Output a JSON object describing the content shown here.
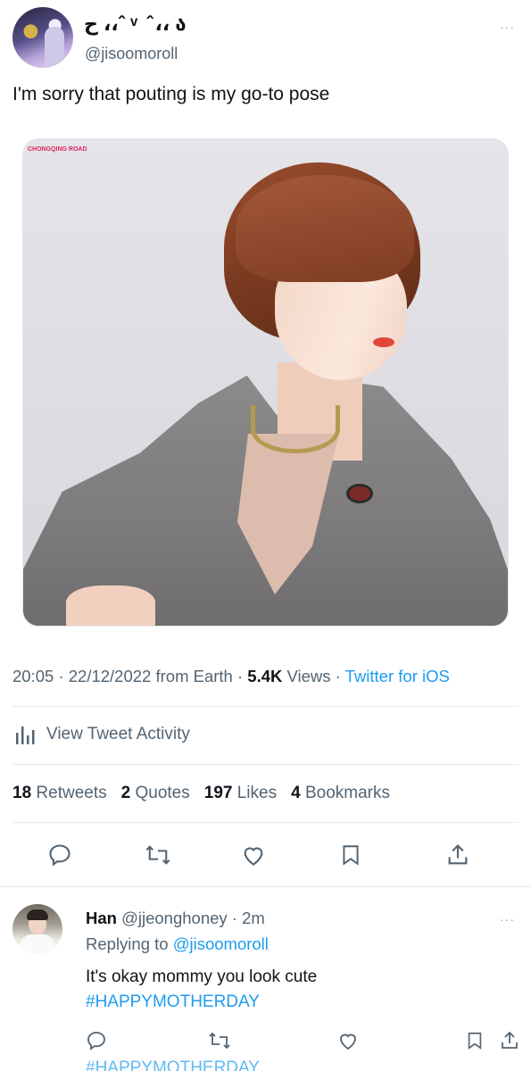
{
  "tweet": {
    "display_name": "ح ،،ˆ ᵛ ˆ،، ა",
    "handle": "@jisoomoroll",
    "text": "I'm sorry that pouting is my go-to pose",
    "photo_caption": "CHONGQING ROAD",
    "time": "20:05",
    "date": "22/12/2022",
    "from": "from Earth",
    "views_count": "5.4K",
    "views_label": "Views",
    "source": "Twitter for iOS",
    "sep": "·",
    "activity_label": "View Tweet Activity",
    "stats": {
      "retweets_count": "18",
      "retweets_label": "Retweets",
      "quotes_count": "2",
      "quotes_label": "Quotes",
      "likes_count": "197",
      "likes_label": "Likes",
      "bookmarks_count": "4",
      "bookmarks_label": "Bookmarks"
    },
    "more": "···"
  },
  "reply": {
    "name": "Han",
    "handle": "@jjeonghoney",
    "age": "2m",
    "sep": "·",
    "replying_prefix": "Replying to",
    "replying_handle": "@jisoomoroll",
    "text": "It's okay mommy you look cute",
    "hashtag": "#HAPPYMOTHERDAY",
    "cut_text": "#HAPPYMOTHERDAY",
    "more": "···"
  },
  "colors": {
    "link": "#1d9bf0",
    "muted": "#536471",
    "text": "#0f1419"
  }
}
